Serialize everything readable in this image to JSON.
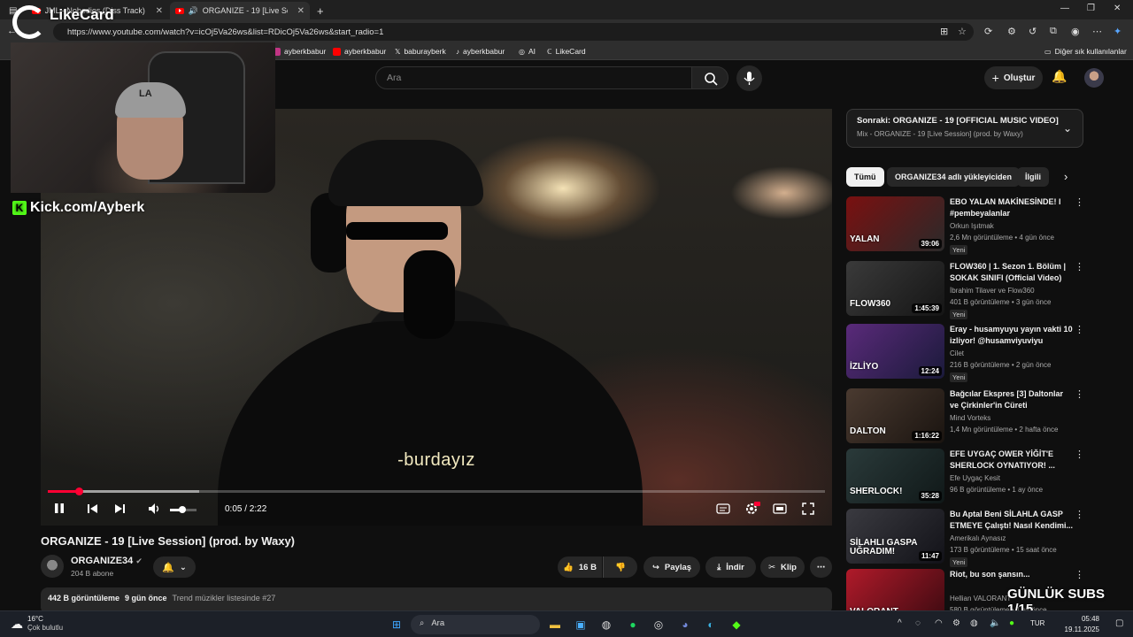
{
  "browser": {
    "tabs": [
      {
        "title": "JML - Nobodies (Diss Track) #DD"
      },
      {
        "title": "ORGANIZE - 19 [Live Session"
      }
    ],
    "new_tab": "+",
    "url": "https://www.youtube.com/watch?v=icOj5Va26ws&list=RDicOj5Va26ws&start_radio=1",
    "bookmarks": [
      "ayberkbabur",
      "ayberkbabur",
      "baburayberk",
      "ayberkbabur",
      "AI",
      "LikeCard"
    ],
    "other_bookmarks": "Diğer sık kullanılanlar"
  },
  "youtube": {
    "search_placeholder": "Ara",
    "create_label": "Oluştur"
  },
  "video": {
    "subtitle": "-burdayız",
    "time": "0:05 / 2:22",
    "progress_fraction": 0.04,
    "buffer_fraction": 0.195,
    "volume_fraction": 0.45,
    "title": "ORGANIZE - 19 [Live Session] (prod. by Waxy)",
    "channel": "ORGANIZE34",
    "subscribers": "204 B abone",
    "like_count": "16 B",
    "share_label": "Paylaş",
    "download_label": "İndir",
    "clip_label": "Klip",
    "views": "442 B görüntüleme",
    "age": "9 gün önce",
    "trend": "Trend müzikler listesinde #27"
  },
  "overlay": {
    "brand": "LikeCard",
    "kick": "Kick.com/Ayberk",
    "subs_counter": "GÜNLÜK SUBS 1/15"
  },
  "upnext": {
    "title": "Sonraki: ORGANIZE - 19 [OFFICIAL MUSIC VIDEO]",
    "subtitle": "Mix - ORGANIZE - 19 [Live Session] (prod. by Waxy)"
  },
  "chips": [
    "Tümü",
    "ORGANIZE34 adlı yükleyiciden",
    "İlgili"
  ],
  "recommendations": [
    {
      "title": "EBO YALAN MAKİNESİNDE! l #pembeyalanlar",
      "channel": "Orkun Işıtmak",
      "meta": "2,6 Mn görüntüleme • 4 gün önce",
      "badge": "Yeni",
      "duration": "39:06",
      "thumb_text": "YALAN",
      "colors": [
        "#7a1010",
        "#2a2a2a"
      ]
    },
    {
      "title": "FLOW360 | 1. Sezon 1. Bölüm | SOKAK SINIFI (Official Video)",
      "channel": "İbrahim Tilaver ve Flow360",
      "meta": "401 B görüntüleme • 3 gün önce",
      "badge": "Yeni",
      "duration": "1:45:39",
      "thumb_text": "FLOW360",
      "colors": [
        "#3a3a3a",
        "#151515"
      ]
    },
    {
      "title": "Eray - husamyuyu yayın vakti 10 izliyor! @husamviyuviyu",
      "channel": "Cilet",
      "meta": "216 B görüntüleme • 2 gün önce",
      "badge": "Yeni",
      "duration": "12:24",
      "thumb_text": "İZLİYO",
      "colors": [
        "#5a2a7a",
        "#1a1a3a"
      ]
    },
    {
      "title": "Bağcılar Ekspres [3] Daltonlar ve Çirkinler'in Cüreti",
      "channel": "Mind Vorteks",
      "meta": "1,4 Mn görüntüleme • 2 hafta önce",
      "badge": "",
      "duration": "1:16:22",
      "thumb_text": "DALTON",
      "colors": [
        "#4a3a30",
        "#1a1410"
      ]
    },
    {
      "title": "EFE UYGAÇ OWER YİĞİT'E SHERLOCK OYNATIYOR! ...",
      "channel": "Efe Uygaç Kesit",
      "meta": "96 B görüntüleme • 1 ay önce",
      "badge": "",
      "duration": "35:28",
      "thumb_text": "SHERLOCK!",
      "colors": [
        "#2a3a3a",
        "#101818"
      ]
    },
    {
      "title": "Bu Aptal Beni SİLAHLA GASP ETMEYE Çalıştı! Nasıl Kendimi...",
      "channel": "Amerikalı Aynasız",
      "meta": "173 B görüntüleme • 15 saat önce",
      "badge": "Yeni",
      "duration": "11:47",
      "thumb_text": "SİLAHLI GASPA UĞRADIM!",
      "colors": [
        "#3a3a40",
        "#121218"
      ]
    },
    {
      "title": "Riot, bu son şansın...",
      "channel": "Hellian VALORANT",
      "meta": "580 B görüntüleme • 1 ay önce",
      "badge": "",
      "duration": "",
      "thumb_text": "VALORANT",
      "colors": [
        "#b01a2a",
        "#3a0a10"
      ]
    }
  ],
  "taskbar": {
    "temp": "16°C",
    "weather": "Çok bulutlu",
    "search": "Ara",
    "lang": "TUR",
    "time": "05:48",
    "date": "19.11.2025"
  }
}
